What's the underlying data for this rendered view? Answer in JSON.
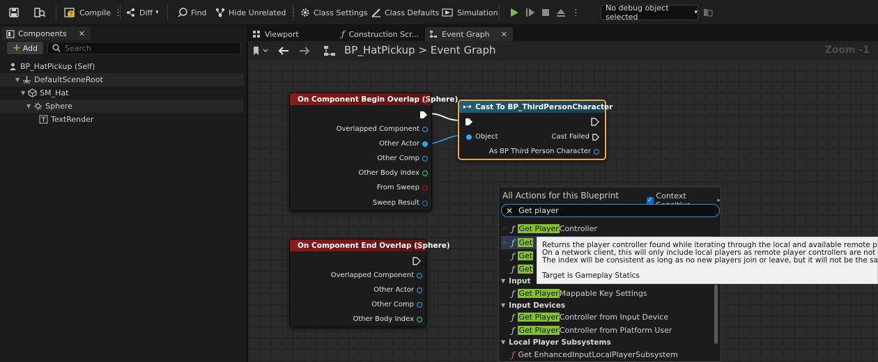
{
  "toolbar": {
    "compile_label": "Compile",
    "diff_label": "Diff",
    "find_label": "Find",
    "hide_unrelated_label": "Hide Unrelated",
    "class_settings_label": "Class Settings",
    "class_defaults_label": "Class Defaults",
    "simulation_label": "Simulation",
    "debug_select_value": "No debug object selected"
  },
  "components_panel": {
    "tab_label": "Components",
    "add_label": "Add",
    "search_placeholder": "Search",
    "tree": [
      {
        "label": "BP_HatPickup (Self)"
      },
      {
        "label": "DefaultSceneRoot"
      },
      {
        "label": "SM_Hat"
      },
      {
        "label": "Sphere"
      },
      {
        "label": "TextRender"
      }
    ]
  },
  "editor_tabs": [
    {
      "label": "Viewport"
    },
    {
      "label": "Construction Scr..."
    },
    {
      "label": "Event Graph"
    }
  ],
  "breadcrumb": {
    "blueprint": "BP_HatPickup",
    "separator": ">",
    "graph": "Event Graph",
    "zoom": "Zoom -1"
  },
  "nodes": {
    "begin_overlap": {
      "title": "On Component Begin Overlap (Sphere)",
      "pins": [
        "Overlapped Component",
        "Other Actor",
        "Other Comp",
        "Other Body Index",
        "From Sweep",
        "Sweep Result"
      ]
    },
    "cast": {
      "title": "Cast To BP_ThirdPersonCharacter",
      "object_pin": "Object",
      "cast_failed": "Cast Failed",
      "as_pin": "As BP Third Person Character"
    },
    "end_overlap": {
      "title": "On Component End Overlap (Sphere)",
      "pins": [
        "Overlapped Component",
        "Other Actor",
        "Other Comp",
        "Other Body Index"
      ]
    }
  },
  "actions_menu": {
    "title": "All Actions for this Blueprint",
    "context_sensitive_label": "Context Sensitive",
    "search_value": "Get player",
    "highlight": "Get Player",
    "rows": [
      {
        "kind": "item",
        "hl": "Get Player",
        "rest": "Controller"
      },
      {
        "kind": "item",
        "hl": "Get",
        "rest": ""
      },
      {
        "kind": "item",
        "hl": "Get",
        "rest": ""
      },
      {
        "kind": "item",
        "hl": "Get",
        "rest": ""
      },
      {
        "kind": "cat",
        "label": "Input"
      },
      {
        "kind": "item",
        "hl": "Get Player",
        "rest": "Mappable Key Settings"
      },
      {
        "kind": "cat",
        "label": "Input Devices"
      },
      {
        "kind": "item",
        "hl": "Get Player",
        "rest": "Controller from Input Device"
      },
      {
        "kind": "item",
        "hl": "Get Player",
        "rest": "Controller from Platform User"
      },
      {
        "kind": "cat",
        "label": "Local Player Subsystems"
      },
      {
        "kind": "item",
        "hl": "",
        "rest": "Get EnhancedInputLocalPlayerSubsystem"
      }
    ]
  },
  "tooltip": {
    "line1": "Returns the player controller found while iterating through the local and available remote player controllers.",
    "line2": "On a network client, this will only include local players as remote player controllers are not available.",
    "line3": "The index will be consistent as long as no new players join or leave, but it will not be the same across different clie",
    "line4": "Target is Gameplay Statics"
  },
  "colors": {
    "event_header": "#8a1a1a",
    "cast_header": "#1f5f74",
    "selection_outline": "#f2a83a",
    "object_pin": "#29a6f0",
    "highlight": "#86c22a",
    "play_green": "#6ec24d"
  }
}
